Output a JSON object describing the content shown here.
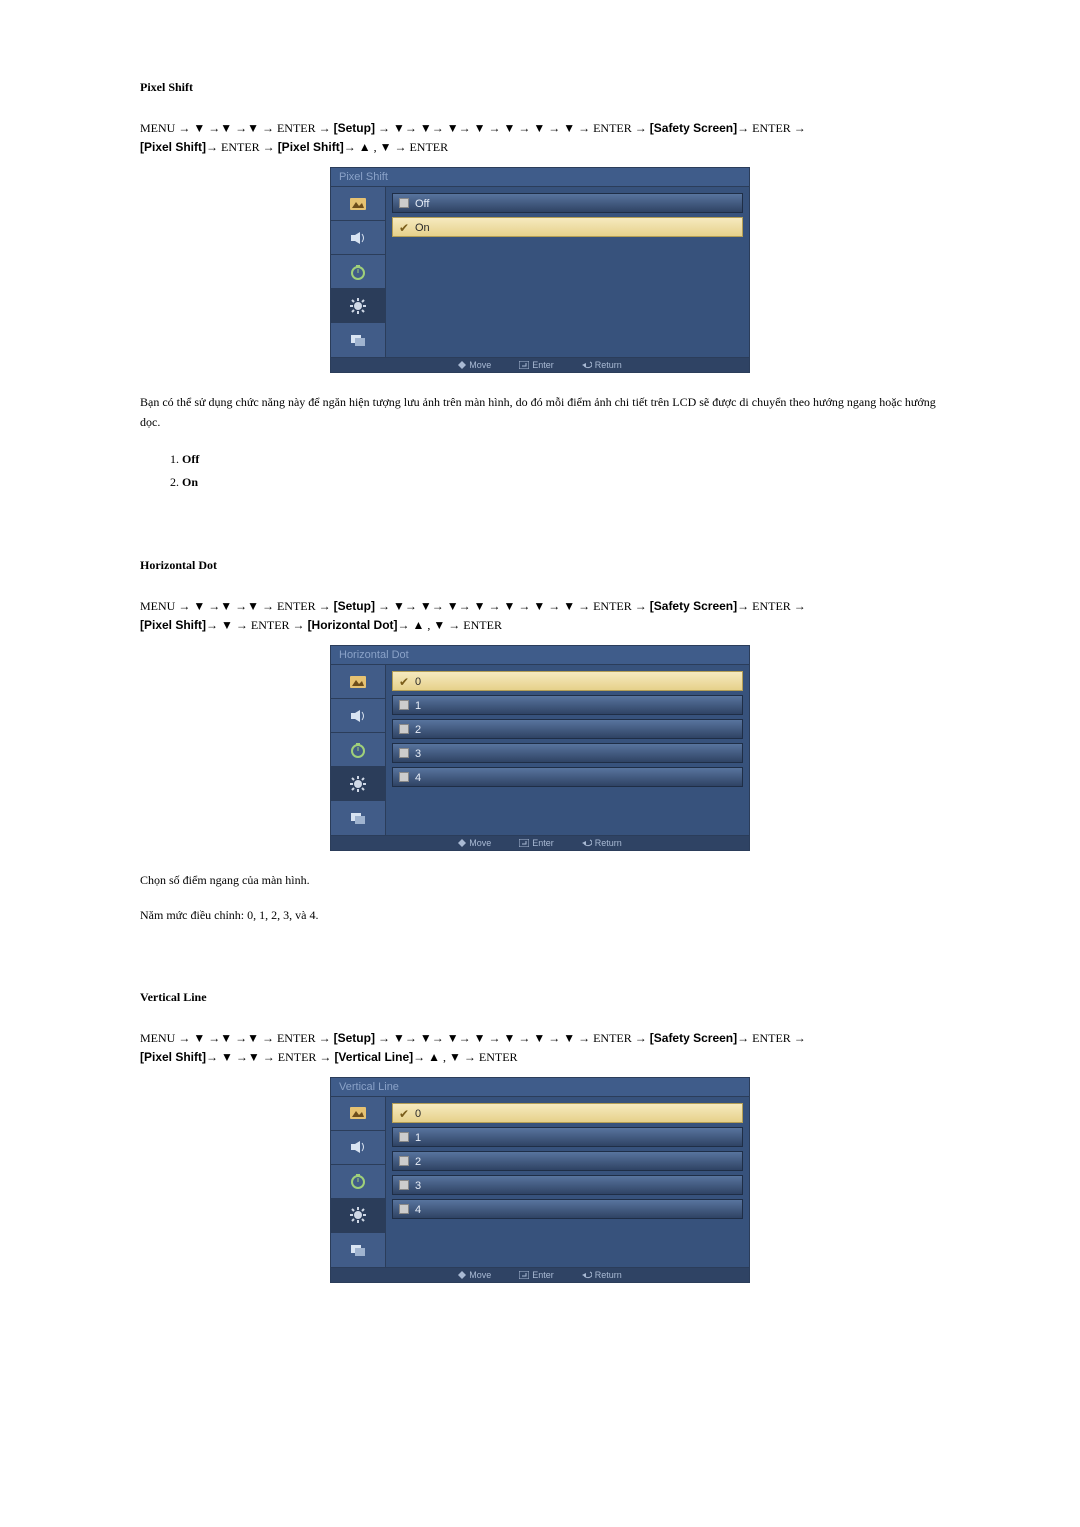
{
  "sections": {
    "pixelShift": {
      "title": "Pixel Shift",
      "navPlain1": "MENU → ▼ →▼ →▼ → ENTER → ",
      "navBold1": "[Setup]",
      "navPlain2": " → ▼→ ▼→ ▼→ ▼ → ▼ → ▼ → ▼ → ENTER → ",
      "navBold2": "[Safety Screen]",
      "navPlain3": "→ ENTER → ",
      "navBold3": "[Pixel Shift]",
      "navPlain4": "→ ENTER → ",
      "navBold4": "[Pixel Shift]",
      "navPlain5": "→ ▲ , ▼ → ENTER",
      "menuTitle": "Pixel Shift",
      "options": [
        "Off",
        "On"
      ],
      "selectedIndex": 1,
      "footer": {
        "move": "Move",
        "enter": "Enter",
        "return": "Return"
      },
      "desc": "Bạn có thể sử dụng chức năng này để ngăn hiện tượng lưu ảnh trên màn hình, do đó mỗi điểm ảnh chi tiết trên LCD sẽ được di chuyển theo hướng ngang hoặc hướng dọc.",
      "list": [
        "Off",
        "On"
      ]
    },
    "horizontalDot": {
      "title": "Horizontal Dot",
      "navPlain1": "MENU → ▼ →▼ →▼ → ENTER → ",
      "navBold1": "[Setup]",
      "navPlain2": " → ▼→ ▼→ ▼→ ▼ → ▼ → ▼ → ▼ → ENTER → ",
      "navBold2": "[Safety Screen]",
      "navPlain3": "→ ENTER → ",
      "navBold3": "[Pixel Shift]",
      "navPlain4": "→ ▼ → ENTER → ",
      "navBold4": "[Horizontal Dot]",
      "navPlain5": "→ ▲ , ▼ → ENTER",
      "menuTitle": "Horizontal Dot",
      "options": [
        "0",
        "1",
        "2",
        "3",
        "4"
      ],
      "selectedIndex": 0,
      "footer": {
        "move": "Move",
        "enter": "Enter",
        "return": "Return"
      },
      "desc1": "Chọn số điểm ngang của màn hình.",
      "desc2": "Năm mức điều chỉnh: 0, 1, 2, 3, và 4."
    },
    "verticalLine": {
      "title": "Vertical Line",
      "navPlain1": "MENU → ▼ →▼ →▼ → ENTER → ",
      "navBold1": "[Setup]",
      "navPlain2": " → ▼→ ▼→ ▼→ ▼ → ▼ → ▼ → ▼ → ENTER → ",
      "navBold2": "[Safety Screen]",
      "navPlain3": "→ ENTER → ",
      "navBold3": "[Pixel Shift]",
      "navPlain4": "→ ▼ →▼ → ENTER → ",
      "navBold4": "[Vertical Line]",
      "navPlain5": "→ ▲ , ▼ → ENTER",
      "menuTitle": "Vertical Line",
      "options": [
        "0",
        "1",
        "2",
        "3",
        "4"
      ],
      "selectedIndex": 0,
      "footer": {
        "move": "Move",
        "enter": "Enter",
        "return": "Return"
      }
    }
  }
}
